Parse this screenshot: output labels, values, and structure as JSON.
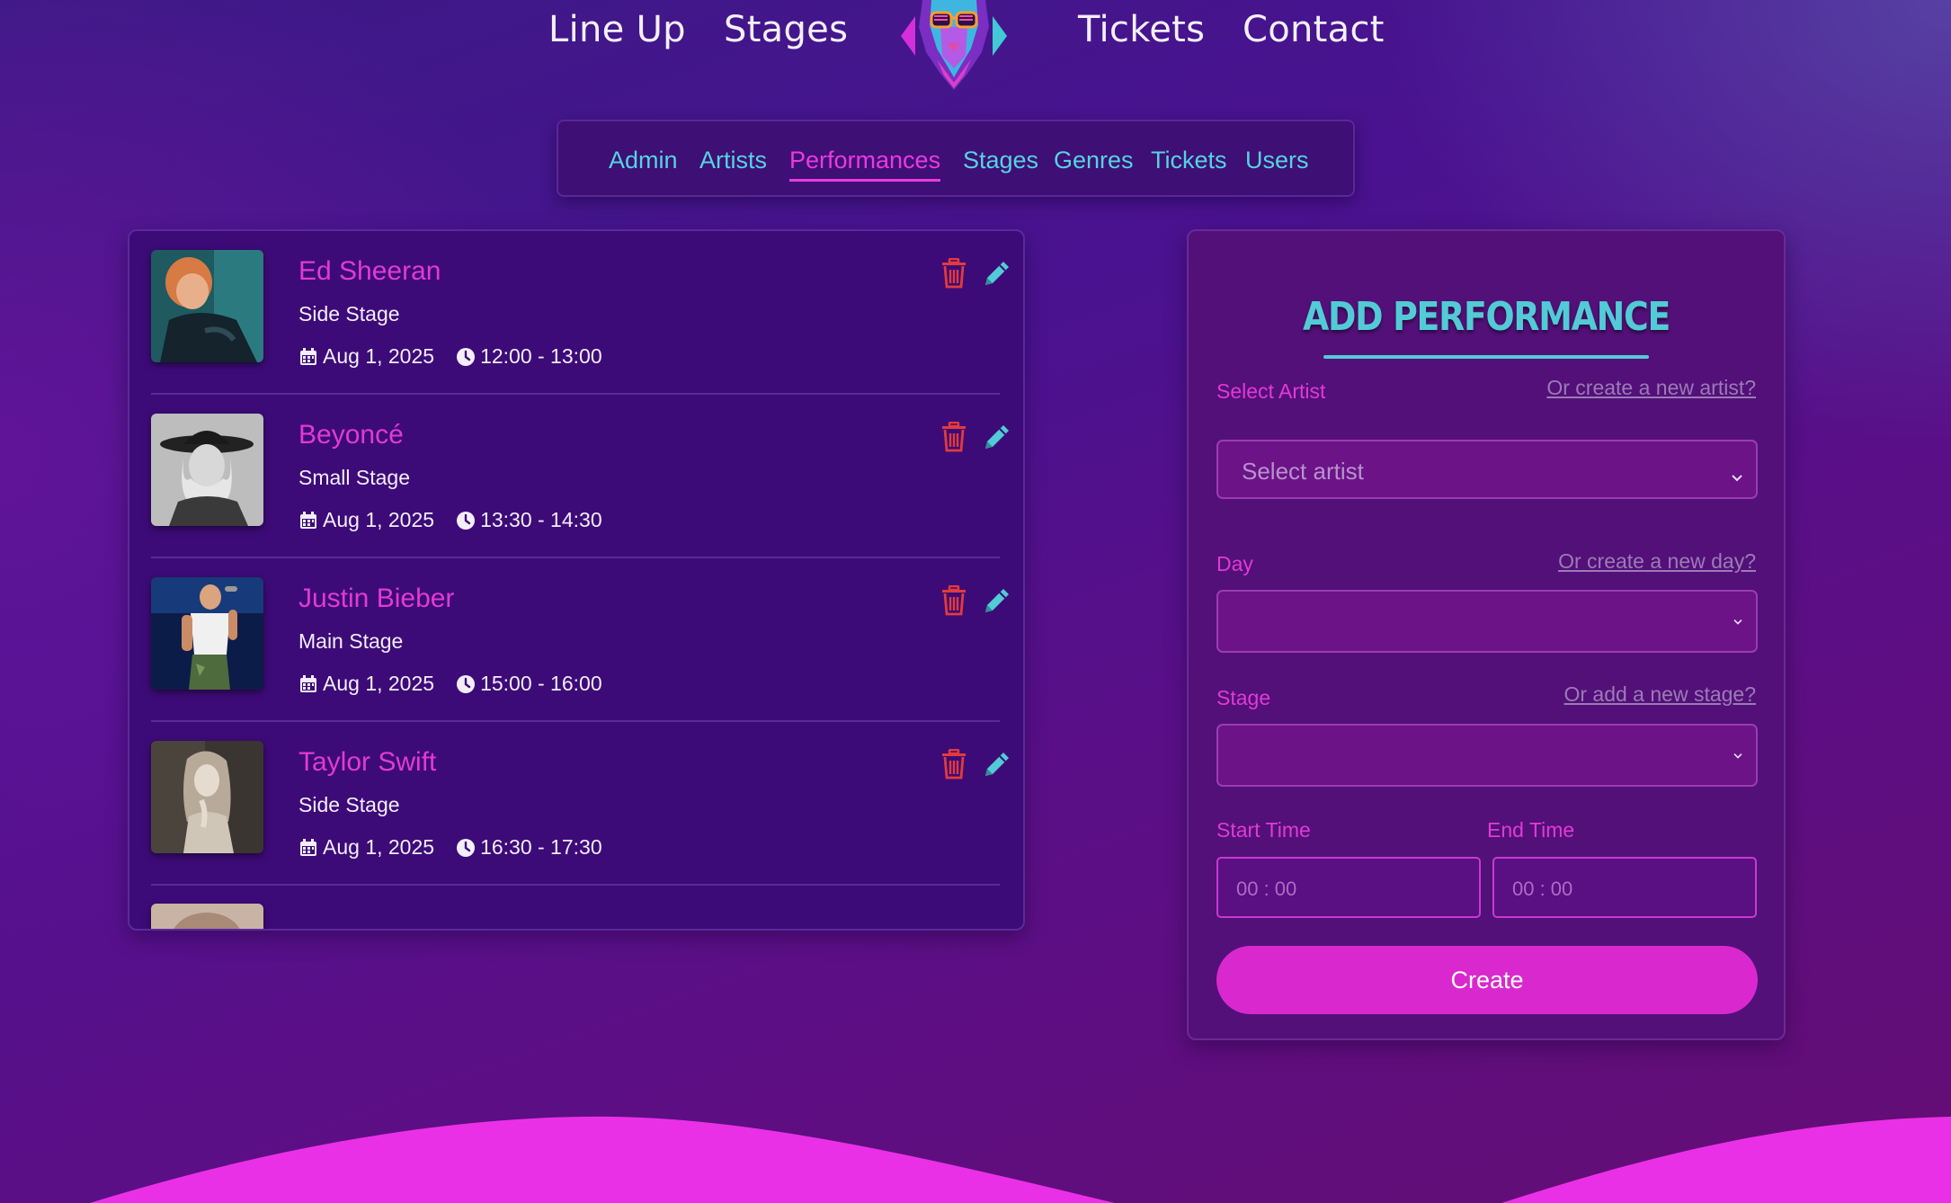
{
  "top_nav": {
    "line_up": "Line Up",
    "stages": "Stages",
    "tickets": "Tickets",
    "contact": "Contact"
  },
  "admin_tabs": [
    {
      "label": "Admin"
    },
    {
      "label": "Artists"
    },
    {
      "label": "Performances",
      "active": true
    },
    {
      "label": "Stages"
    },
    {
      "label": "Genres"
    },
    {
      "label": "Tickets"
    },
    {
      "label": "Users"
    }
  ],
  "performances": [
    {
      "artist": "Ed Sheeran",
      "stage": "Side Stage",
      "date": "Aug 1, 2025",
      "time": "12:00 - 13:00"
    },
    {
      "artist": "Beyoncé",
      "stage": "Small Stage",
      "date": "Aug 1, 2025",
      "time": "13:30 - 14:30"
    },
    {
      "artist": "Justin Bieber",
      "stage": "Main Stage",
      "date": "Aug 1, 2025",
      "time": "15:00 - 16:00"
    },
    {
      "artist": "Taylor Swift",
      "stage": "Side Stage",
      "date": "Aug 1, 2025",
      "time": "16:30 - 17:30"
    }
  ],
  "form": {
    "title": "ADD PERFORMANCE",
    "artist_label": "Select Artist",
    "artist_link": "Or create a new artist?",
    "artist_placeholder": "Select artist",
    "day_label": "Day",
    "day_link": "Or create a new day?",
    "day_value": "",
    "stage_label": "Stage",
    "stage_link": "Or add a new stage?",
    "stage_value": "",
    "start_label": "Start Time",
    "end_label": "End Time",
    "start_value": "00 : 00",
    "end_value": "00 : 00",
    "submit": "Create"
  },
  "colors": {
    "accent_pink": "#e13ad6",
    "accent_cyan": "#52cbd6",
    "delete_red": "#e23b3b",
    "button_pink": "#d928ce"
  },
  "icons": {
    "date": "calendar-icon",
    "time": "clock-icon",
    "delete": "trash-icon",
    "edit": "pencil-icon"
  }
}
